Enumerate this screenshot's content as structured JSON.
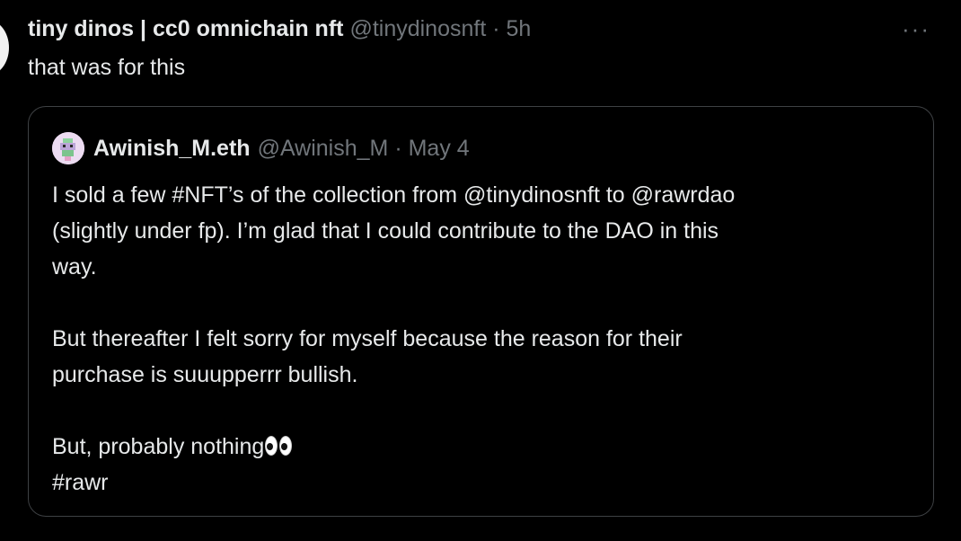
{
  "tweet": {
    "author_name": "tiny dinos | cc0 omnichain nft",
    "handle": "@tinydinosnft",
    "separator": "·",
    "time": "5h",
    "more": "···",
    "text": "that was for this"
  },
  "quote": {
    "author_name": "Awinish_M.eth",
    "handle": "@Awinish_M",
    "separator": "·",
    "date": "May 4",
    "lines": [
      "I sold a few #NFT’s of the collection from @tinydinosnft to @rawrdao",
      "(slightly under fp). I’m glad that I could contribute to the DAO in this",
      "way.",
      "But thereafter I felt sorry for myself because the reason for their",
      "purchase is suuupperrr bullish.",
      "But, probably nothing",
      "#rawr"
    ]
  },
  "colors": {
    "background": "#000000",
    "text": "#e7e9ea",
    "muted": "#71767b",
    "border": "#3e4144"
  },
  "icons": {
    "more": "more-dots-icon",
    "emoji": "eyes-icon"
  }
}
